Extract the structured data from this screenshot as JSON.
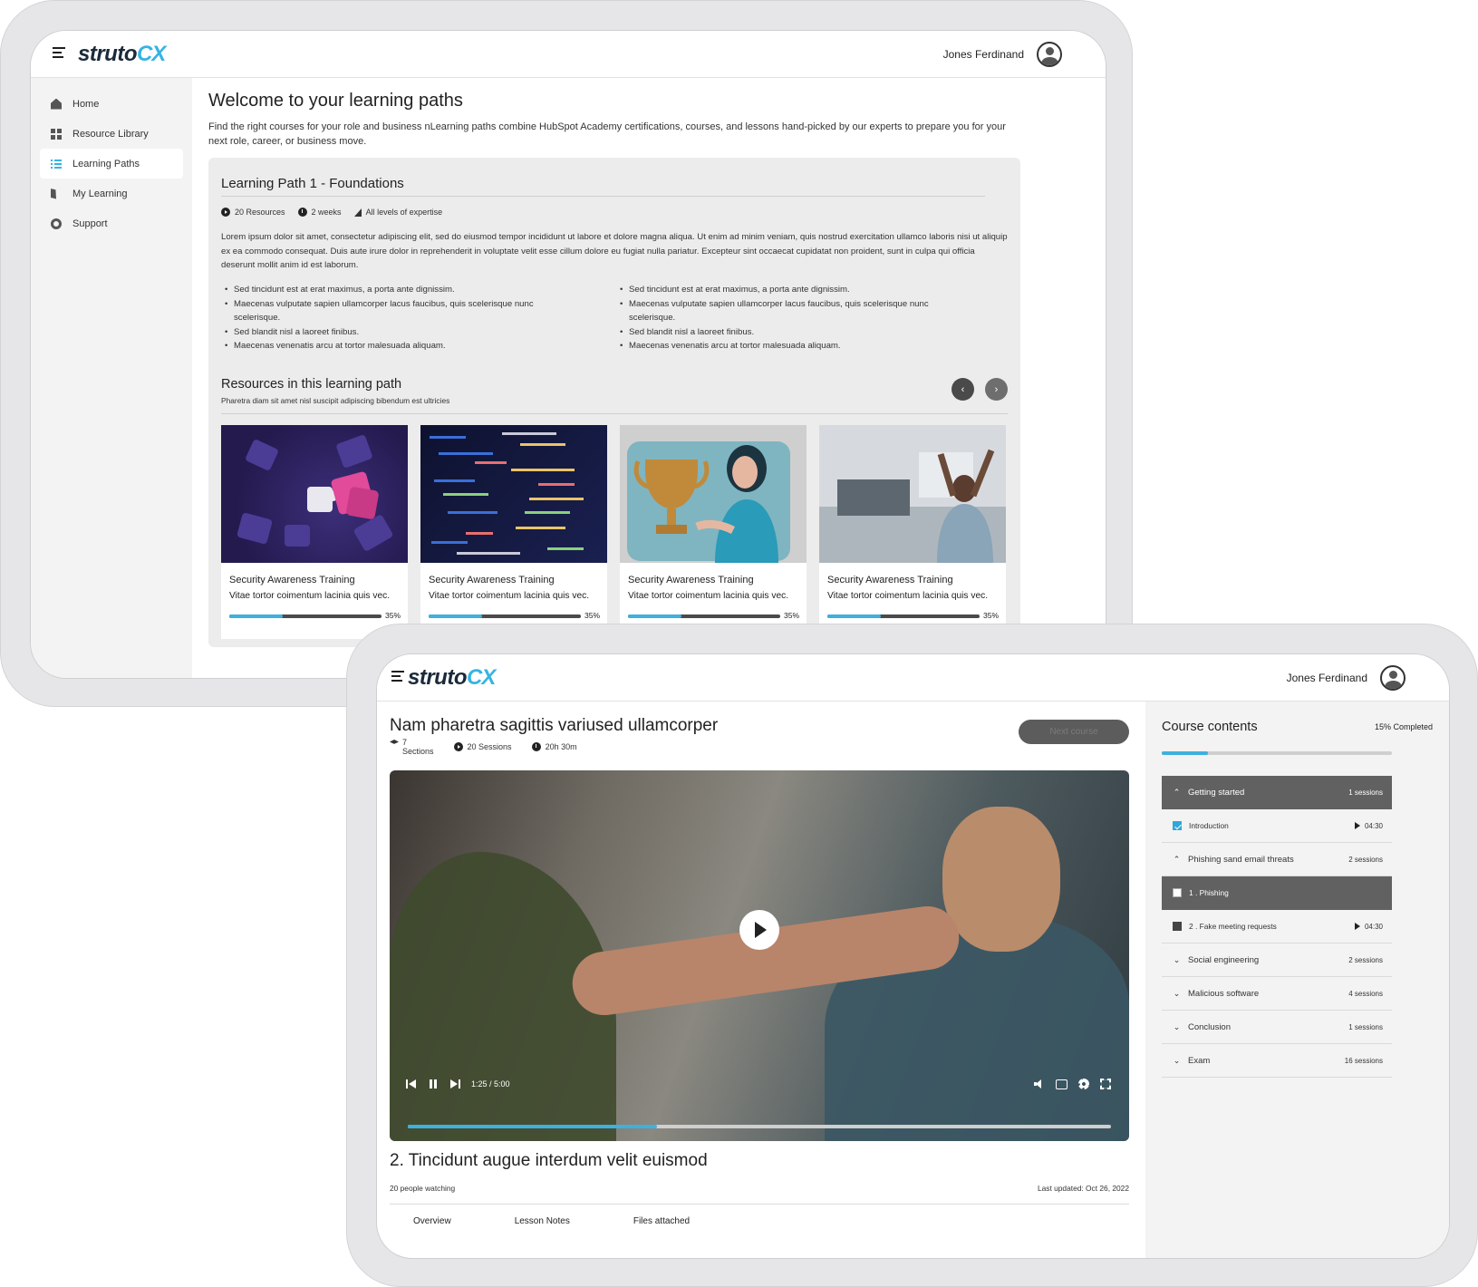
{
  "brand": {
    "logo_part1": "struto",
    "logo_part2": "CX",
    "accent": "#36b4e3"
  },
  "user": {
    "name": "Jones Ferdinand"
  },
  "sidebar": {
    "items": [
      {
        "label": "Home",
        "icon": "home-icon"
      },
      {
        "label": "Resource Library",
        "icon": "grid-icon"
      },
      {
        "label": "Learning Paths",
        "icon": "list-icon",
        "active": true
      },
      {
        "label": "My Learning",
        "icon": "book-icon"
      },
      {
        "label": "Support",
        "icon": "lifebuoy-icon"
      }
    ]
  },
  "learning_paths": {
    "title": "Welcome to your learning paths",
    "intro": "Find the right courses for your role and business nLearning paths combine HubSpot Academy certifications, courses, and lessons hand-picked by our experts to prepare you for your next role, career, or business move.",
    "path": {
      "title": "Learning Path 1 - Foundations",
      "resources": "20 Resources",
      "duration": "2 weeks",
      "level": "All levels of expertise",
      "description": "Lorem ipsum dolor sit amet, consectetur adipiscing elit, sed do eiusmod tempor incididunt ut labore et dolore magna aliqua. Ut enim ad minim veniam, quis nostrud exercitation ullamco laboris nisi ut aliquip ex ea commodo consequat. Duis aute irure dolor in reprehenderit in voluptate velit esse cillum dolore eu fugiat nulla pariatur. Excepteur sint occaecat cupidatat non proident, sunt in culpa qui officia deserunt mollit anim id est laborum.",
      "bullets_left": [
        "Sed tincidunt est at erat maximus, a porta ante dignissim.",
        "Maecenas vulputate sapien ullamcorper lacus faucibus, quis scelerisque nunc scelerisque.",
        "Sed blandit nisl a laoreet finibus.",
        "Maecenas venenatis arcu at tortor malesuada aliquam."
      ],
      "bullets_right": [
        "Sed tincidunt est at erat maximus, a porta ante dignissim.",
        "Maecenas vulputate sapien ullamcorper lacus faucibus, quis scelerisque nunc scelerisque.",
        "Sed blandit nisl a laoreet finibus.",
        "Maecenas venenatis arcu at tortor malesuada aliquam."
      ]
    },
    "resources": {
      "title": "Resources in this learning path",
      "subtitle": "Pharetra diam sit amet nisl suscipit adipiscing bibendum est ultricies",
      "prev_label": "‹",
      "next_label": "›",
      "cards": [
        {
          "title": "Security Awareness Training",
          "subtitle": "Vitae tortor coimentum lacinia quis vec.",
          "progress": 0.35,
          "progress_label": "35%"
        },
        {
          "title": "Security Awareness Training",
          "subtitle": "Vitae tortor coimentum lacinia quis vec.",
          "progress": 0.35,
          "progress_label": "35%"
        },
        {
          "title": "Security Awareness Training",
          "subtitle": "Vitae tortor coimentum lacinia quis vec.",
          "progress": 0.35,
          "progress_label": "35%"
        },
        {
          "title": "Security Awareness Training",
          "subtitle": "Vitae tortor coimentum lacinia quis vec.",
          "progress": 0.35,
          "progress_label": "35%"
        }
      ]
    }
  },
  "course": {
    "title": "Nam pharetra sagittis variused ullamcorper",
    "sections_count": "7",
    "sections_label": "Sections",
    "sessions": "20 Sessions",
    "duration": "20h 30m",
    "next_button": "Next course",
    "video": {
      "time": "1:25 / 5:00",
      "progress": 0.355
    },
    "lesson_title": "2. Tincidunt augue interdum velit euismod",
    "watching": "20 people watching",
    "updated": "Last updated: Oct 26, 2022",
    "tabs": [
      "Overview",
      "Lesson Notes",
      "Files attached"
    ]
  },
  "contents": {
    "title": "Course contents",
    "completed": "15% Completed",
    "progress": 0.2,
    "rows": [
      {
        "type": "section",
        "label": "Getting started",
        "count": "1 sessions",
        "open": true,
        "dark": true
      },
      {
        "type": "lesson",
        "label": "Introduction",
        "duration": "04:30",
        "checked": true
      },
      {
        "type": "section",
        "label": "Phishing sand email threats",
        "count": "2 sessions",
        "open": true
      },
      {
        "type": "lesson",
        "label": "1 . Phishing",
        "dark": true
      },
      {
        "type": "lesson",
        "label": "2 . Fake meeting requests",
        "duration": "04:30",
        "dkbox": true
      },
      {
        "type": "section",
        "label": "Social engineering",
        "count": "2 sessions"
      },
      {
        "type": "section",
        "label": "Malicious software",
        "count": "4 sessions"
      },
      {
        "type": "section",
        "label": "Conclusion",
        "count": "1 sessions"
      },
      {
        "type": "section",
        "label": "Exam",
        "count": "16 sessions"
      }
    ]
  }
}
